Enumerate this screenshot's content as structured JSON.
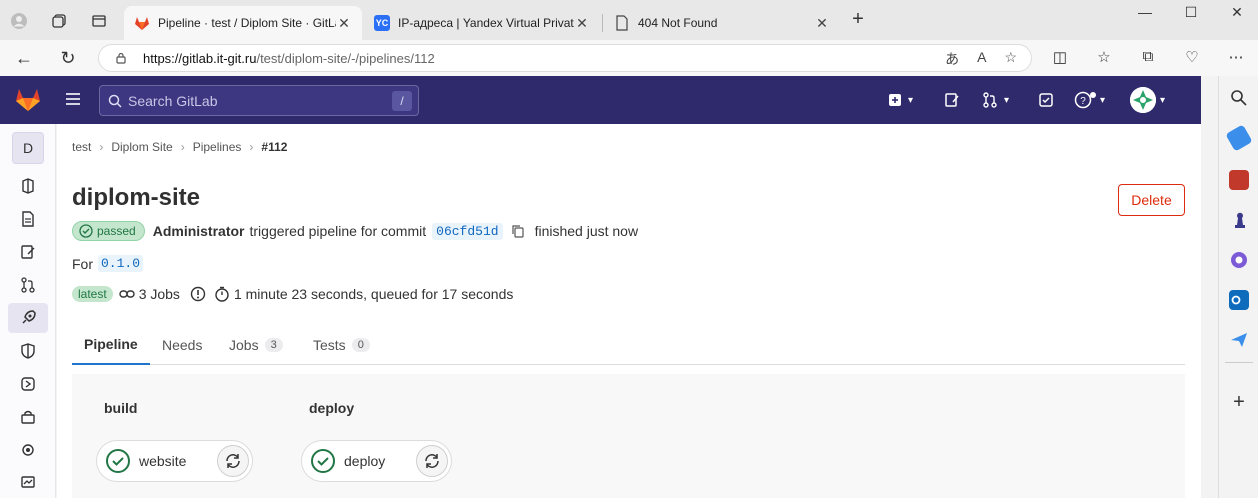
{
  "browser": {
    "tabs": [
      {
        "title": "Pipeline · test / Diplom Site · GitLab",
        "active": true
      },
      {
        "title": "IP-адреса | Yandex Virtual Private Cloud",
        "favicon_text": "YC",
        "active": false
      },
      {
        "title": "404 Not Found",
        "active": false
      }
    ],
    "url_host": "https://gitlab.it-git.ru",
    "url_path": "/test/diplom-site/-/pipelines/112"
  },
  "gitlab": {
    "search_placeholder": "Search GitLab",
    "search_shortcut": "/",
    "project_initial": "D",
    "breadcrumbs": [
      "test",
      "Diplom Site",
      "Pipelines",
      "#112"
    ],
    "title": "diplom-site",
    "delete_label": "Delete",
    "status_badge": "passed",
    "author": "Administrator",
    "triggered_text": "triggered pipeline for commit",
    "commit_sha": "06cfd51d",
    "finished_text": "finished just now",
    "for_label": "For",
    "ref": "0.1.0",
    "latest_badge": "latest",
    "jobs_count_text": "3 Jobs",
    "duration_text": "1 minute 23 seconds, queued for 17 seconds",
    "tabs": [
      {
        "label": "Pipeline"
      },
      {
        "label": "Needs"
      },
      {
        "label": "Jobs",
        "count": "3"
      },
      {
        "label": "Tests",
        "count": "0"
      }
    ],
    "stages": [
      {
        "name": "build",
        "job": "website"
      },
      {
        "name": "deploy",
        "job": "deploy"
      }
    ],
    "colors": {
      "topbar": "#2f2a6b",
      "passed": "#217645",
      "link": "#1068bf",
      "danger": "#dd2b0e"
    }
  }
}
